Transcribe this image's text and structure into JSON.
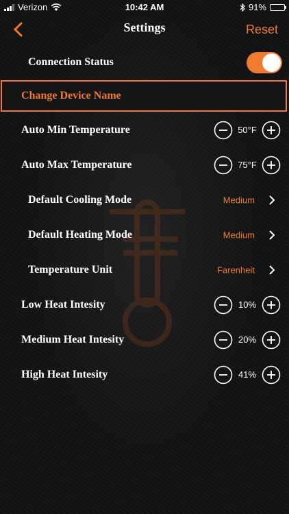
{
  "status_bar": {
    "carrier": "Verizon",
    "time": "10:42 AM",
    "battery": "91%",
    "battery_level": 0.91
  },
  "nav": {
    "title": "Settings",
    "reset": "Reset"
  },
  "settings": {
    "connection_status": {
      "label": "Connection Status",
      "on": true
    },
    "change_device_name": {
      "label": "Change Device Name"
    },
    "auto_min_temp": {
      "label": "Auto Min Temperature",
      "value": "50°F"
    },
    "auto_max_temp": {
      "label": "Auto Max Temperature",
      "value": "75°F"
    },
    "default_cooling": {
      "label": "Default Cooling Mode",
      "value": "Medium"
    },
    "default_heating": {
      "label": "Default Heating Mode",
      "value": "Medium"
    },
    "temp_unit": {
      "label": "Temperature Unit",
      "value": "Farenheit"
    },
    "low_heat": {
      "label": "Low Heat Intesity",
      "value": "10%"
    },
    "medium_heat": {
      "label": "Medium Heat Intesity",
      "value": "20%"
    },
    "high_heat": {
      "label": "High Heat Intesity",
      "value": "41%"
    }
  },
  "colors": {
    "accent": "#f07a2e",
    "background": "#121212",
    "text": "#ffffff"
  }
}
